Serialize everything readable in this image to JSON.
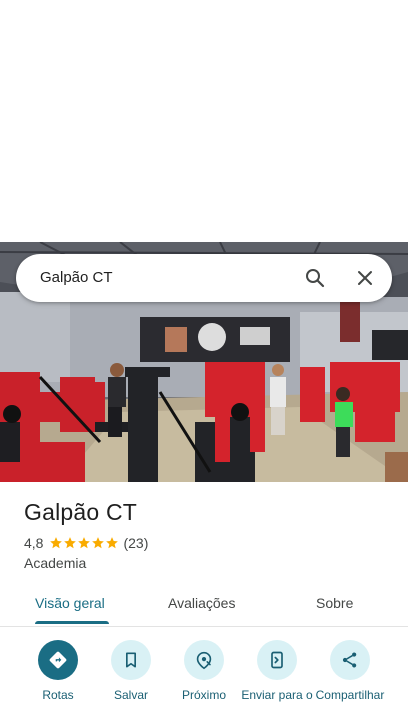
{
  "search": {
    "query": "Galpão CT"
  },
  "place": {
    "name": "Galpão CT",
    "rating": "4,8",
    "stars": 5,
    "review_count": "(23)",
    "category": "Academia"
  },
  "tabs": [
    {
      "label": "Visão geral",
      "active": true
    },
    {
      "label": "Avaliações",
      "active": false
    },
    {
      "label": "Sobre",
      "active": false
    }
  ],
  "actions": [
    {
      "label": "Rotas",
      "icon": "directions-icon"
    },
    {
      "label": "Salvar",
      "icon": "bookmark-icon"
    },
    {
      "label": "Próximo",
      "icon": "nearby-icon"
    },
    {
      "label": "Enviar para o",
      "icon": "send-to-phone-icon"
    },
    {
      "label": "Compartilhar",
      "icon": "share-icon"
    }
  ],
  "colors": {
    "accent": "#1a6d84",
    "action_bg": "#d9f1f5",
    "star": "#f9ab00"
  }
}
